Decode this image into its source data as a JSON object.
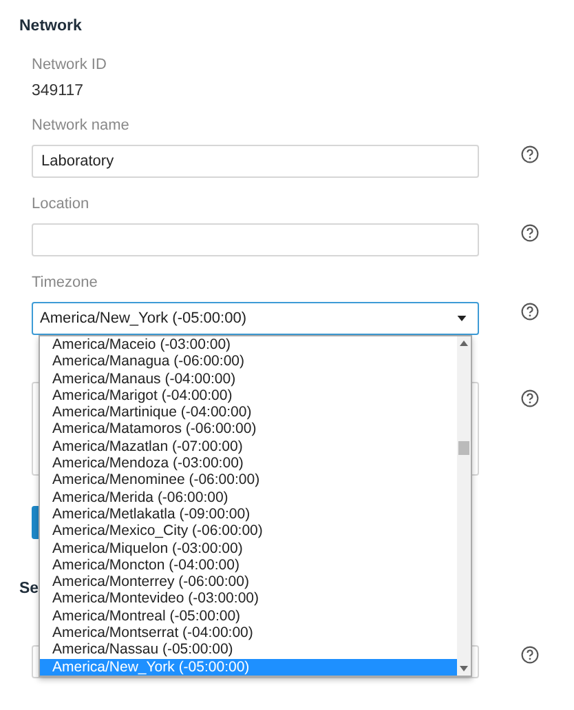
{
  "section_title": "Network",
  "network_id": {
    "label": "Network ID",
    "value": "349117"
  },
  "network_name": {
    "label": "Network name",
    "value": "Laboratory"
  },
  "location": {
    "label": "Location"
  },
  "timezone": {
    "label": "Timezone",
    "value": "America/New_York (-05:00:00)",
    "expanded": true,
    "options": [
      {
        "label": "America/Maceio (-03:00:00)",
        "selected": false
      },
      {
        "label": "America/Managua (-06:00:00)",
        "selected": false
      },
      {
        "label": "America/Manaus (-04:00:00)",
        "selected": false
      },
      {
        "label": "America/Marigot (-04:00:00)",
        "selected": false
      },
      {
        "label": "America/Martinique (-04:00:00)",
        "selected": false
      },
      {
        "label": "America/Matamoros (-06:00:00)",
        "selected": false
      },
      {
        "label": "America/Mazatlan (-07:00:00)",
        "selected": false
      },
      {
        "label": "America/Mendoza (-03:00:00)",
        "selected": false
      },
      {
        "label": "America/Menominee (-06:00:00)",
        "selected": false
      },
      {
        "label": "America/Merida (-06:00:00)",
        "selected": false
      },
      {
        "label": "America/Metlakatla (-09:00:00)",
        "selected": false
      },
      {
        "label": "America/Mexico_City (-06:00:00)",
        "selected": false
      },
      {
        "label": "America/Miquelon (-03:00:00)",
        "selected": false
      },
      {
        "label": "America/Moncton (-04:00:00)",
        "selected": false
      },
      {
        "label": "America/Monterrey (-06:00:00)",
        "selected": false
      },
      {
        "label": "America/Montevideo (-03:00:00)",
        "selected": false
      },
      {
        "label": "America/Montreal (-05:00:00)",
        "selected": false
      },
      {
        "label": "America/Montserrat (-04:00:00)",
        "selected": false
      },
      {
        "label": "America/Nassau (-05:00:00)",
        "selected": false
      },
      {
        "label": "America/New_York (-05:00:00)",
        "selected": true
      }
    ]
  },
  "section_2_title": "Se"
}
